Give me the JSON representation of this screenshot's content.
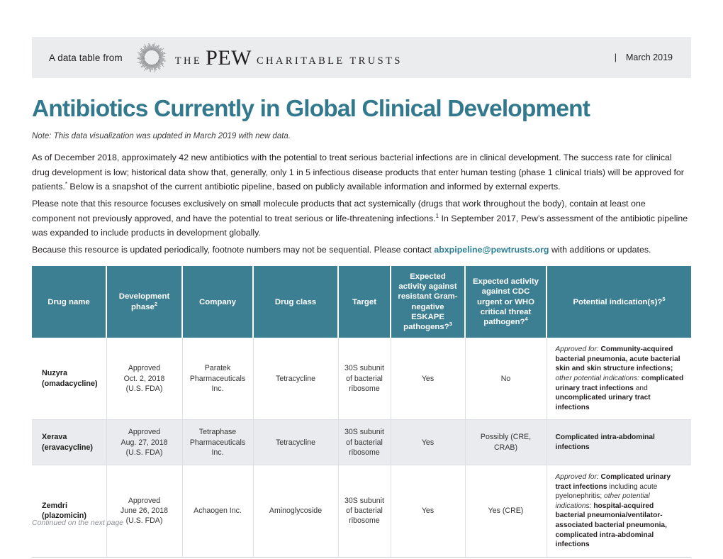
{
  "masthead": {
    "from_text": "A data table from",
    "brand_the": "THE",
    "brand_name": "PEW",
    "brand_ct": "CHARITABLE TRUSTS",
    "separator": "|",
    "date": "March 2019",
    "logo_icon": "sunburst-logo"
  },
  "title": "Antibiotics Currently in Global Clinical Development",
  "note": "Note: This data visualization was updated in March 2019 with new data.",
  "paragraphs": {
    "p1_a": "As of December 2018, approximately 42 new antibiotics with the potential to treat serious bacterial infections are in clinical development. The success rate for clinical drug development is low; historical data show that, generally, only 1 in 5 infectious disease products that enter human testing (phase 1 clinical trials) will be approved for patients.",
    "p1_sup": "*",
    "p1_b": " Below is a snapshot of the current antibiotic pipeline, based on publicly available information and informed by external experts.",
    "p2_a": "Please note that this resource focuses exclusively on small molecule products that act systemically (drugs that work throughout the body), contain at least one component not previously approved, and have the potential to treat serious or life-threatening infections.",
    "p2_sup": "1",
    "p2_b": " In September 2017, Pew’s assessment of the antibiotic pipeline was expanded to include products in development globally.",
    "p3_a": "Because this resource is updated periodically, footnote numbers may not be sequential. Please contact ",
    "p3_link": "abxpipeline@pewtrusts.org",
    "p3_b": " with additions or updates."
  },
  "table": {
    "headers": [
      {
        "label": "Drug name",
        "sup": ""
      },
      {
        "label": "Development phase",
        "sup": "2"
      },
      {
        "label": "Company",
        "sup": ""
      },
      {
        "label": "Drug class",
        "sup": ""
      },
      {
        "label": "Target",
        "sup": ""
      },
      {
        "label": "Expected activity against resistant Gram-negative ESKAPE pathogens?",
        "sup": "3"
      },
      {
        "label": "Expected activity against CDC urgent or WHO critical threat pathogen?",
        "sup": "4"
      },
      {
        "label": "Potential indication(s)?",
        "sup": "5"
      }
    ],
    "rows": [
      {
        "shade": false,
        "drug_name": "Nuzyra\n(omadacycline)",
        "phase": "Approved\nOct. 2, 2018\n(U.S. FDA)",
        "company": "Paratek\nPharmaceuticals Inc.",
        "drug_class": "Tetracycline",
        "target": "30S subunit\nof bacterial\nribosome",
        "eskape": "Yes",
        "cdc_who": "No",
        "indication_parts": [
          {
            "style": "italic",
            "text": "Approved for"
          },
          {
            "style": "italic",
            "text": ": "
          },
          {
            "style": "bold",
            "text": "Community-acquired bacterial pneumonia, acute bacterial skin and skin structure infections; "
          },
          {
            "style": "italic",
            "text": "other potential indications"
          },
          {
            "style": "italic",
            "text": ": "
          },
          {
            "style": "bold",
            "text": "complicated urinary tract infections "
          },
          {
            "style": "normal",
            "text": "and "
          },
          {
            "style": "bold",
            "text": "uncomplicated urinary tract infections"
          }
        ]
      },
      {
        "shade": true,
        "drug_name": "Xerava\n(eravacycline)",
        "phase": "Approved\nAug. 27, 2018\n(U.S. FDA)",
        "company": "Tetraphase\nPharmaceuticals Inc.",
        "drug_class": "Tetracycline",
        "target": "30S subunit\nof bacterial\nribosome",
        "eskape": "Yes",
        "cdc_who": "Possibly (CRE, CRAB)",
        "indication_parts": [
          {
            "style": "bold",
            "text": "Complicated intra-abdominal infections"
          }
        ]
      },
      {
        "shade": false,
        "drug_name": "Zemdri\n(plazomicin)",
        "phase": "Approved\nJune 26, 2018\n(U.S. FDA)",
        "company": "Achaogen Inc.",
        "drug_class": "Aminoglycoside",
        "target": "30S subunit\nof bacterial\nribosome",
        "eskape": "Yes",
        "cdc_who": "Yes (CRE)",
        "indication_parts": [
          {
            "style": "italic",
            "text": "Approved for"
          },
          {
            "style": "italic",
            "text": ": "
          },
          {
            "style": "bold",
            "text": "Complicated urinary tract infections "
          },
          {
            "style": "normal",
            "text": "including acute pyelonephritis; "
          },
          {
            "style": "italic",
            "text": "other potential indications"
          },
          {
            "style": "italic",
            "text": ": "
          },
          {
            "style": "bold",
            "text": "hospital-acquired bacterial pneumonia/ventilator- associated bacterial pneumonia, complicated intra-abdominal infections"
          }
        ]
      }
    ]
  },
  "footer": "Continued on the next page",
  "colors": {
    "brand_teal": "#33798d",
    "header_teal": "#3d7f92",
    "masthead_grey": "#ebecee",
    "row_shade": "#e9ebee",
    "link_teal": "#2d7f95"
  }
}
